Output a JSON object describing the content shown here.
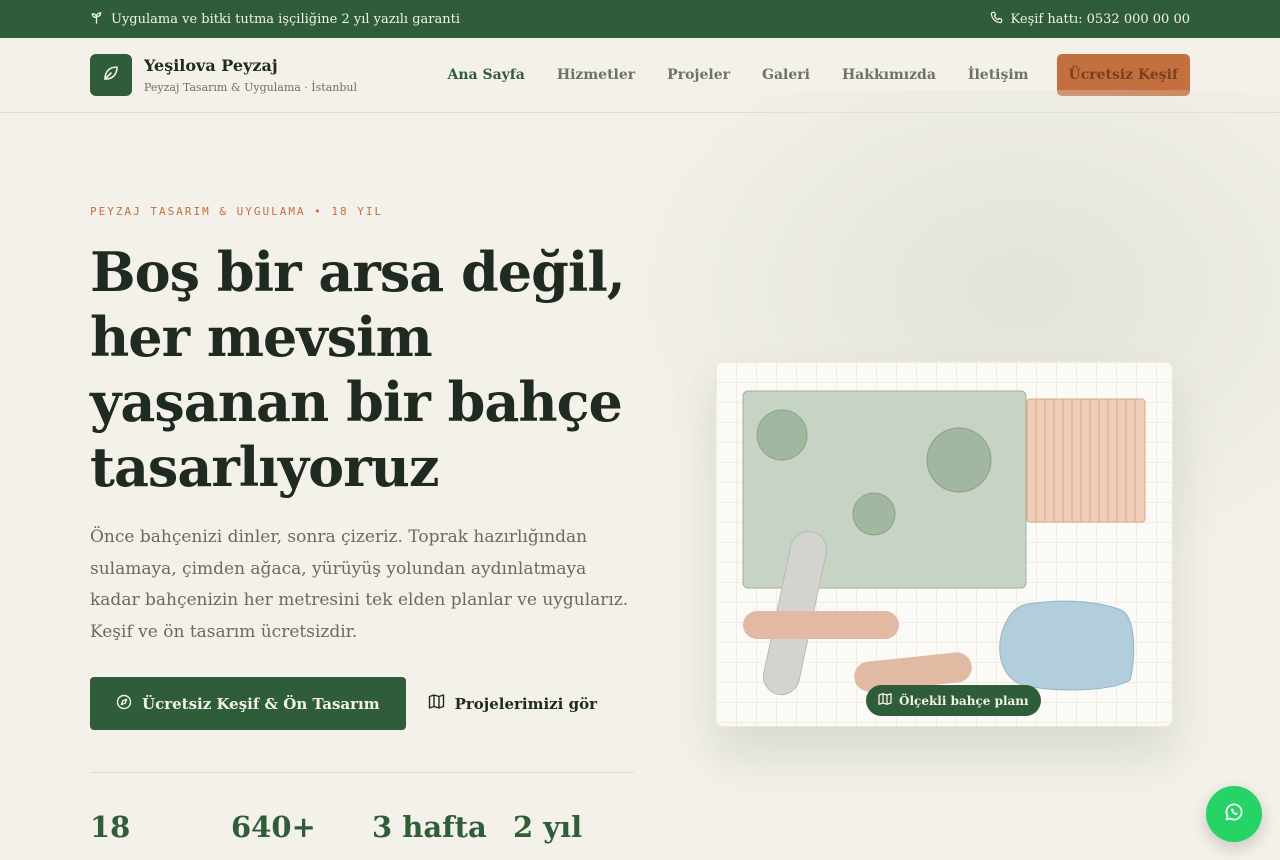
{
  "topbar": {
    "guarantee": "Uygulama ve bitki tutma işçiliğine 2 yıl yazılı garanti",
    "phone": "Keşif hattı: 0532 000 00 00"
  },
  "brand": {
    "name": "Yeşilova Peyzaj",
    "tagline": "Peyzaj Tasarım & Uygulama · İstanbul"
  },
  "nav": {
    "items": [
      "Ana Sayfa",
      "Hizmetler",
      "Projeler",
      "Galeri",
      "Hakkımızda",
      "İletişim"
    ],
    "cta": "Ücretsiz Keşif"
  },
  "hero": {
    "eyebrow": "PEYZAJ TASARIM & UYGULAMA • 18 YIL",
    "headline": "Boş bir arsa değil, her mevsim yaşanan bir bahçe tasarlıyoruz",
    "lead": "Önce bahçenizi dinler, sonra çizeriz. Toprak hazırlığından sulamaya, çimden ağaca, yürüyüş yolundan aydınlatmaya kadar bahçenizin her metresini tek elden planlar ve uygularız. Keşif ve ön tasarım ücretsizdir.",
    "primary_button": "Ücretsiz Keşif & Ön Tasarım",
    "secondary_button": "Projelerimizi gör"
  },
  "stats": [
    "18",
    "640+",
    "3 hafta",
    "2 yıl"
  ],
  "plan": {
    "badge": "Ölçekli bahçe planı"
  },
  "icons": {
    "topbar_guarantee": "sprout-icon",
    "topbar_phone": "phone-icon",
    "logo": "leaf-icon",
    "primary_button": "compass-icon",
    "secondary_button": "map-icon",
    "plan_badge": "map-icon",
    "floating": "whatsapp-icon"
  },
  "colors": {
    "brand_green": "#2f5d3a",
    "accent_terracotta": "#c46f40",
    "background": "#f3f1e9",
    "whatsapp": "#25d366"
  }
}
